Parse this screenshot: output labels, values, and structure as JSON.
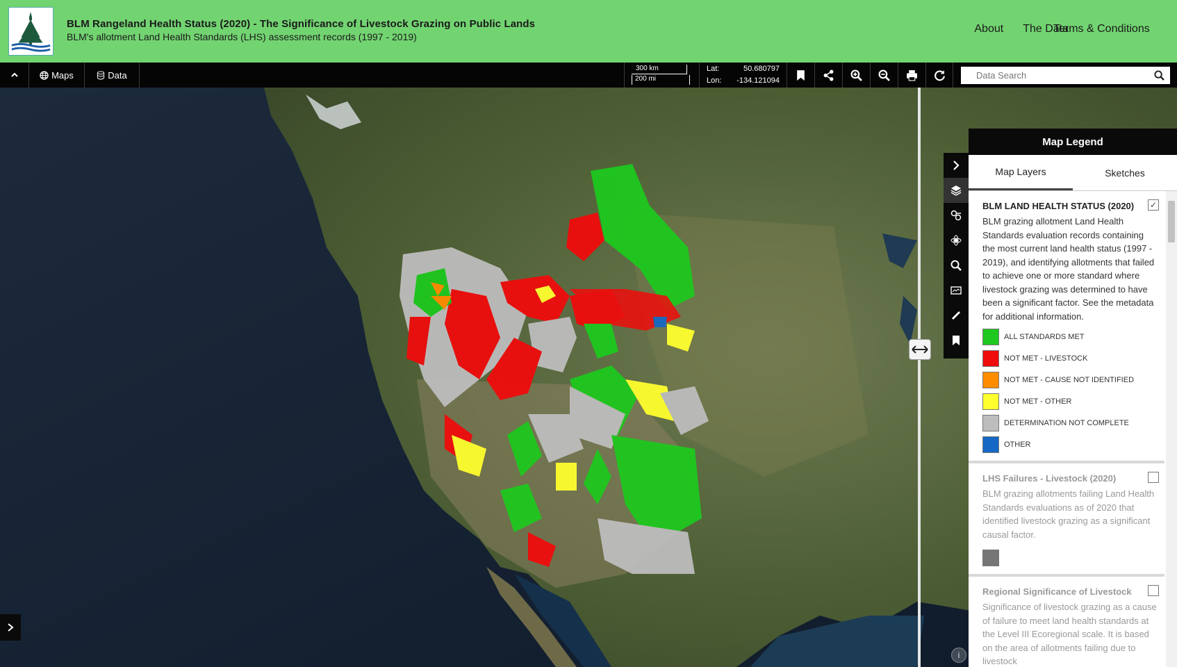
{
  "header": {
    "title": "BLM Rangeland Health Status (2020) - The Significance of Livestock Grazing on Public Lands",
    "subtitle": "BLM's allotment Land Health Standards (LHS) assessment records (1997 - 2019)",
    "nav": [
      "About",
      "The Data",
      "Terms & Conditions"
    ]
  },
  "toolbar": {
    "maps_label": "Maps",
    "data_label": "Data",
    "scale_km": "300 km",
    "scale_mi": "200 mi",
    "lat_label": "Lat:",
    "lat_value": "50.680797",
    "lon_label": "Lon:",
    "lon_value": "-134.121094",
    "search_placeholder": "Data Search",
    "icons": [
      "bookmark-icon",
      "share-icon",
      "zoom-in-icon",
      "zoom-out-icon",
      "print-icon",
      "refresh-icon"
    ]
  },
  "legend": {
    "title": "Map Legend",
    "tabs": [
      "Map Layers",
      "Sketches"
    ],
    "side_icons": [
      "chevron-right-icon",
      "layers-icon",
      "identify-icon",
      "analysis-icon",
      "zoom-to-icon",
      "basemap-icon",
      "measure-icon",
      "bookmark-icon"
    ],
    "layers": [
      {
        "title": "BLM LAND HEALTH STATUS (2020)",
        "desc": "BLM grazing allotment Land Health Standards evaluation records containing the most current land health status (1997 - 2019), and identifying allotments that failed to achieve one or more standard where livestock grazing was determined to have been a significant factor. See the metadata for additional information.",
        "checked": true,
        "items": [
          {
            "label": "ALL STANDARDS MET",
            "color": "#1ec81e"
          },
          {
            "label": "NOT MET - LIVESTOCK",
            "color": "#ef0c0c"
          },
          {
            "label": "NOT MET - CAUSE NOT IDENTIFIED",
            "color": "#ff8c00"
          },
          {
            "label": "NOT MET - OTHER",
            "color": "#ffff2e"
          },
          {
            "label": "DETERMINATION NOT COMPLETE",
            "color": "#bdbdbd"
          },
          {
            "label": "OTHER",
            "color": "#1668c4"
          }
        ]
      },
      {
        "title": "LHS Failures - Livestock (2020)",
        "desc": "BLM grazing allotments failing Land Health Standards evaluations as of 2020 that identified livestock grazing as a significant causal factor.",
        "checked": false,
        "swatch": "#767676"
      },
      {
        "title": "Regional Significance of Livestock",
        "desc": "Significance of livestock grazing as a cause of failure to meet land health standards at the Level III Ecoregional scale. It is based on the area of allotments failing due to livestock",
        "checked": false
      }
    ]
  },
  "map": {
    "info_label": "i"
  }
}
